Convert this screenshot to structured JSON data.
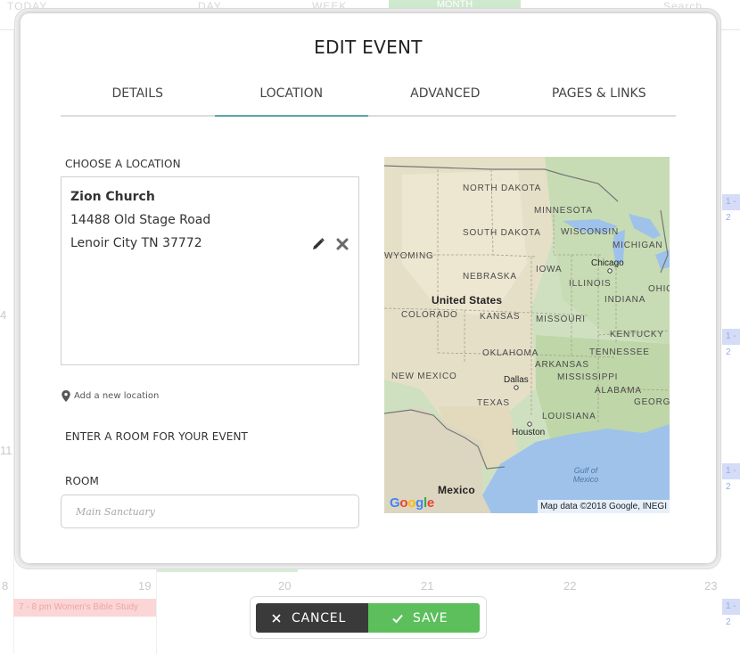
{
  "background": {
    "topbar": {
      "today": "TODAY",
      "day": "DAY",
      "week": "WEEK",
      "month": "MONTH",
      "search": "Search"
    },
    "day_numbers": [
      "4",
      "11",
      "8",
      "19",
      "20",
      "21",
      "22",
      "23"
    ],
    "event_pink": "7 - 8 pm Women's Bible Study",
    "event_blue": "1 - 2"
  },
  "modal": {
    "title": "EDIT EVENT",
    "tabs": [
      {
        "label": "DETAILS"
      },
      {
        "label": "LOCATION"
      },
      {
        "label": "ADVANCED"
      },
      {
        "label": "PAGES & LINKS"
      }
    ],
    "active_tab": "LOCATION",
    "accent_color": "#5aa4b0"
  },
  "location": {
    "section_label": "CHOOSE A LOCATION",
    "name": "Zion Church",
    "address_line1": "14488 Old Stage Road",
    "address_line2": "Lenoir City TN 37772",
    "edit_icon": "pencil-icon",
    "remove_icon": "close-icon",
    "add_new_label": "Add a new location",
    "add_new_icon": "map-pin-icon"
  },
  "room": {
    "section_label": "ENTER A ROOM FOR YOUR EVENT",
    "field_label": "ROOM",
    "placeholder": "Main Sanctuary",
    "value": ""
  },
  "map": {
    "states": [
      "NORTH DAKOTA",
      "MINNESOTA",
      "SOUTH DAKOTA",
      "WISCONSIN",
      "MICHIGAN",
      "WYOMING",
      "NEBRASKA",
      "IOWA",
      "ILLINOIS",
      "INDIANA",
      "OHIO",
      "COLORADO",
      "KANSAS",
      "MISSOURI",
      "KENTUCKY",
      "OKLAHOMA",
      "ARKANSAS",
      "TENNESSEE",
      "NEW MEXICO",
      "MISSISSIPPI",
      "ALABAMA",
      "GEORGIA",
      "TEXAS",
      "LOUISIANA"
    ],
    "country_us": "United States",
    "country_mx": "Mexico",
    "cities": [
      "Chicago",
      "Dallas",
      "Houston"
    ],
    "water": "Gulf of Mexico",
    "logo": "Google",
    "attribution": "Map data ©2018 Google, INEGI"
  },
  "actions": {
    "cancel_label": "CANCEL",
    "save_label": "SAVE",
    "cancel_color": "#3a3a3a",
    "save_color": "#5cbf5c"
  }
}
